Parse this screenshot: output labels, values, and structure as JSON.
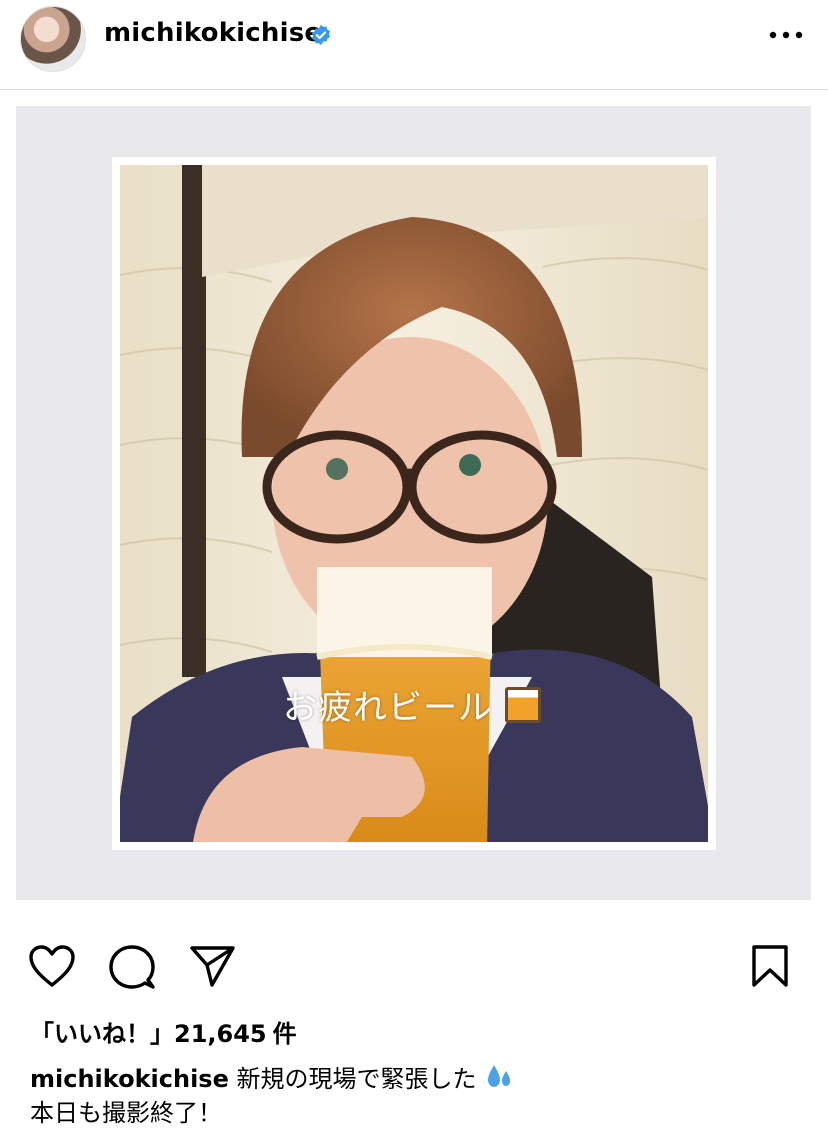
{
  "post": {
    "username": "michikokichise",
    "verified": true,
    "image_overlay_text": "お疲れビール",
    "likes_label": "「いいね！」",
    "likes_count": "21,645",
    "likes_suffix": "件",
    "caption_line1": "新規の現場で緊張した",
    "caption_line2": "本日も撮影終了！"
  },
  "icons": {
    "verified": "verified-badge-icon",
    "more": "more-options-icon",
    "like": "heart-icon",
    "comment": "comment-icon",
    "share": "send-icon",
    "save": "bookmark-icon",
    "beer": "beer-mug-emoji",
    "sweat": "sweat-droplets-emoji"
  },
  "colors": {
    "verified_blue": "#3897f0",
    "divider": "#dbdbdb",
    "frame_bg": "#e9e9ec"
  }
}
